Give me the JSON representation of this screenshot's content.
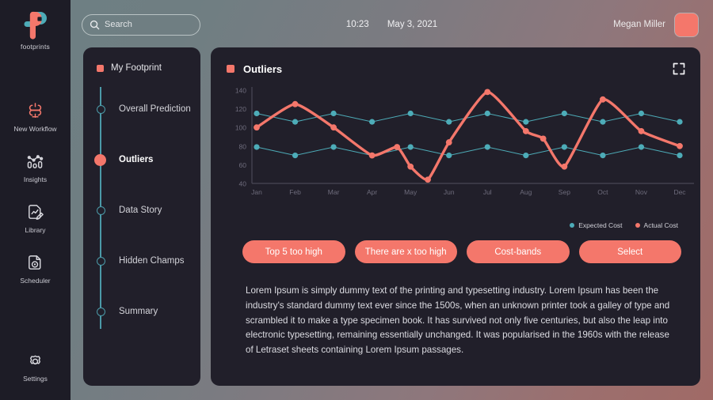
{
  "brand": {
    "name": "footprints",
    "logo_icon": "footprints-logo-icon",
    "teal": "#4dacb8",
    "coral": "#f4776b"
  },
  "sidebar": {
    "items": [
      {
        "label": "New Workflow",
        "icon": "workflow-icon",
        "accent": "#f4776b"
      },
      {
        "label": "Insights",
        "icon": "insights-icon",
        "accent": "#d8d8de"
      },
      {
        "label": "Library",
        "icon": "library-icon",
        "accent": "#d8d8de"
      },
      {
        "label": "Scheduler",
        "icon": "scheduler-icon",
        "accent": "#d8d8de"
      }
    ],
    "settings": {
      "label": "Settings",
      "icon": "gear-icon"
    }
  },
  "header": {
    "search": {
      "placeholder": "Search",
      "value": "",
      "icon": "search-icon"
    },
    "time": "10:23",
    "date": "May 3, 2021",
    "user_name": "Megan Miller",
    "avatar_color": "#f4776b"
  },
  "timeline": {
    "title": "My Footprint",
    "steps": [
      {
        "label": "Overall Prediction",
        "active": false
      },
      {
        "label": "Outliers",
        "active": true
      },
      {
        "label": "Data Story",
        "active": false
      },
      {
        "label": "Hidden Champs",
        "active": false
      },
      {
        "label": "Summary",
        "active": false
      }
    ]
  },
  "card": {
    "title": "Outliers",
    "expand_icon": "expand-icon",
    "buttons": [
      {
        "label": "Top 5 too high"
      },
      {
        "label": "There are x too high"
      },
      {
        "label": "Cost-bands"
      },
      {
        "label": "Select"
      }
    ],
    "body": "Lorem Ipsum is simply dummy text of the printing and typesetting industry. Lorem Ipsum has been the industry's standard dummy text ever since the 1500s, when an unknown printer took a galley of type and scrambled it to make a type specimen book. It has survived not only five centuries, but also the leap into electronic typesetting, remaining essentially unchanged. It was popularised in the 1960s with the release of Letraset sheets containing Lorem Ipsum passages."
  },
  "chart_data": {
    "type": "line",
    "title": "Outliers",
    "xlabel": "",
    "ylabel": "",
    "ylim": [
      40,
      140
    ],
    "yticks": [
      40,
      60,
      80,
      100,
      120,
      140
    ],
    "grid": false,
    "legend_position": "bottom-right",
    "categories": [
      "Jan",
      "Feb",
      "Mar",
      "Apr",
      "May",
      "Jun",
      "Jul",
      "Aug",
      "Sep",
      "Oct",
      "Nov",
      "Dec"
    ],
    "series": [
      {
        "name": "Expected Cost",
        "color": "#4dacb8",
        "values": [
          115,
          106,
          115,
          106,
          115,
          106,
          115,
          106,
          115,
          106,
          115,
          106
        ]
      },
      {
        "name": "Expected Cost",
        "color": "#4dacb8",
        "values": [
          79,
          70,
          79,
          70,
          79,
          70,
          79,
          70,
          79,
          70,
          79,
          70
        ]
      },
      {
        "name": "Actual Cost",
        "color": "#f4776b",
        "values": [
          100,
          125,
          100,
          70,
          58,
          84,
          138,
          96,
          58,
          130,
          96,
          80
        ],
        "extra_points": [
          {
            "x": 3.65,
            "y": 79
          },
          {
            "x": 4.45,
            "y": 44
          },
          {
            "x": 7.45,
            "y": 88
          }
        ]
      }
    ]
  }
}
